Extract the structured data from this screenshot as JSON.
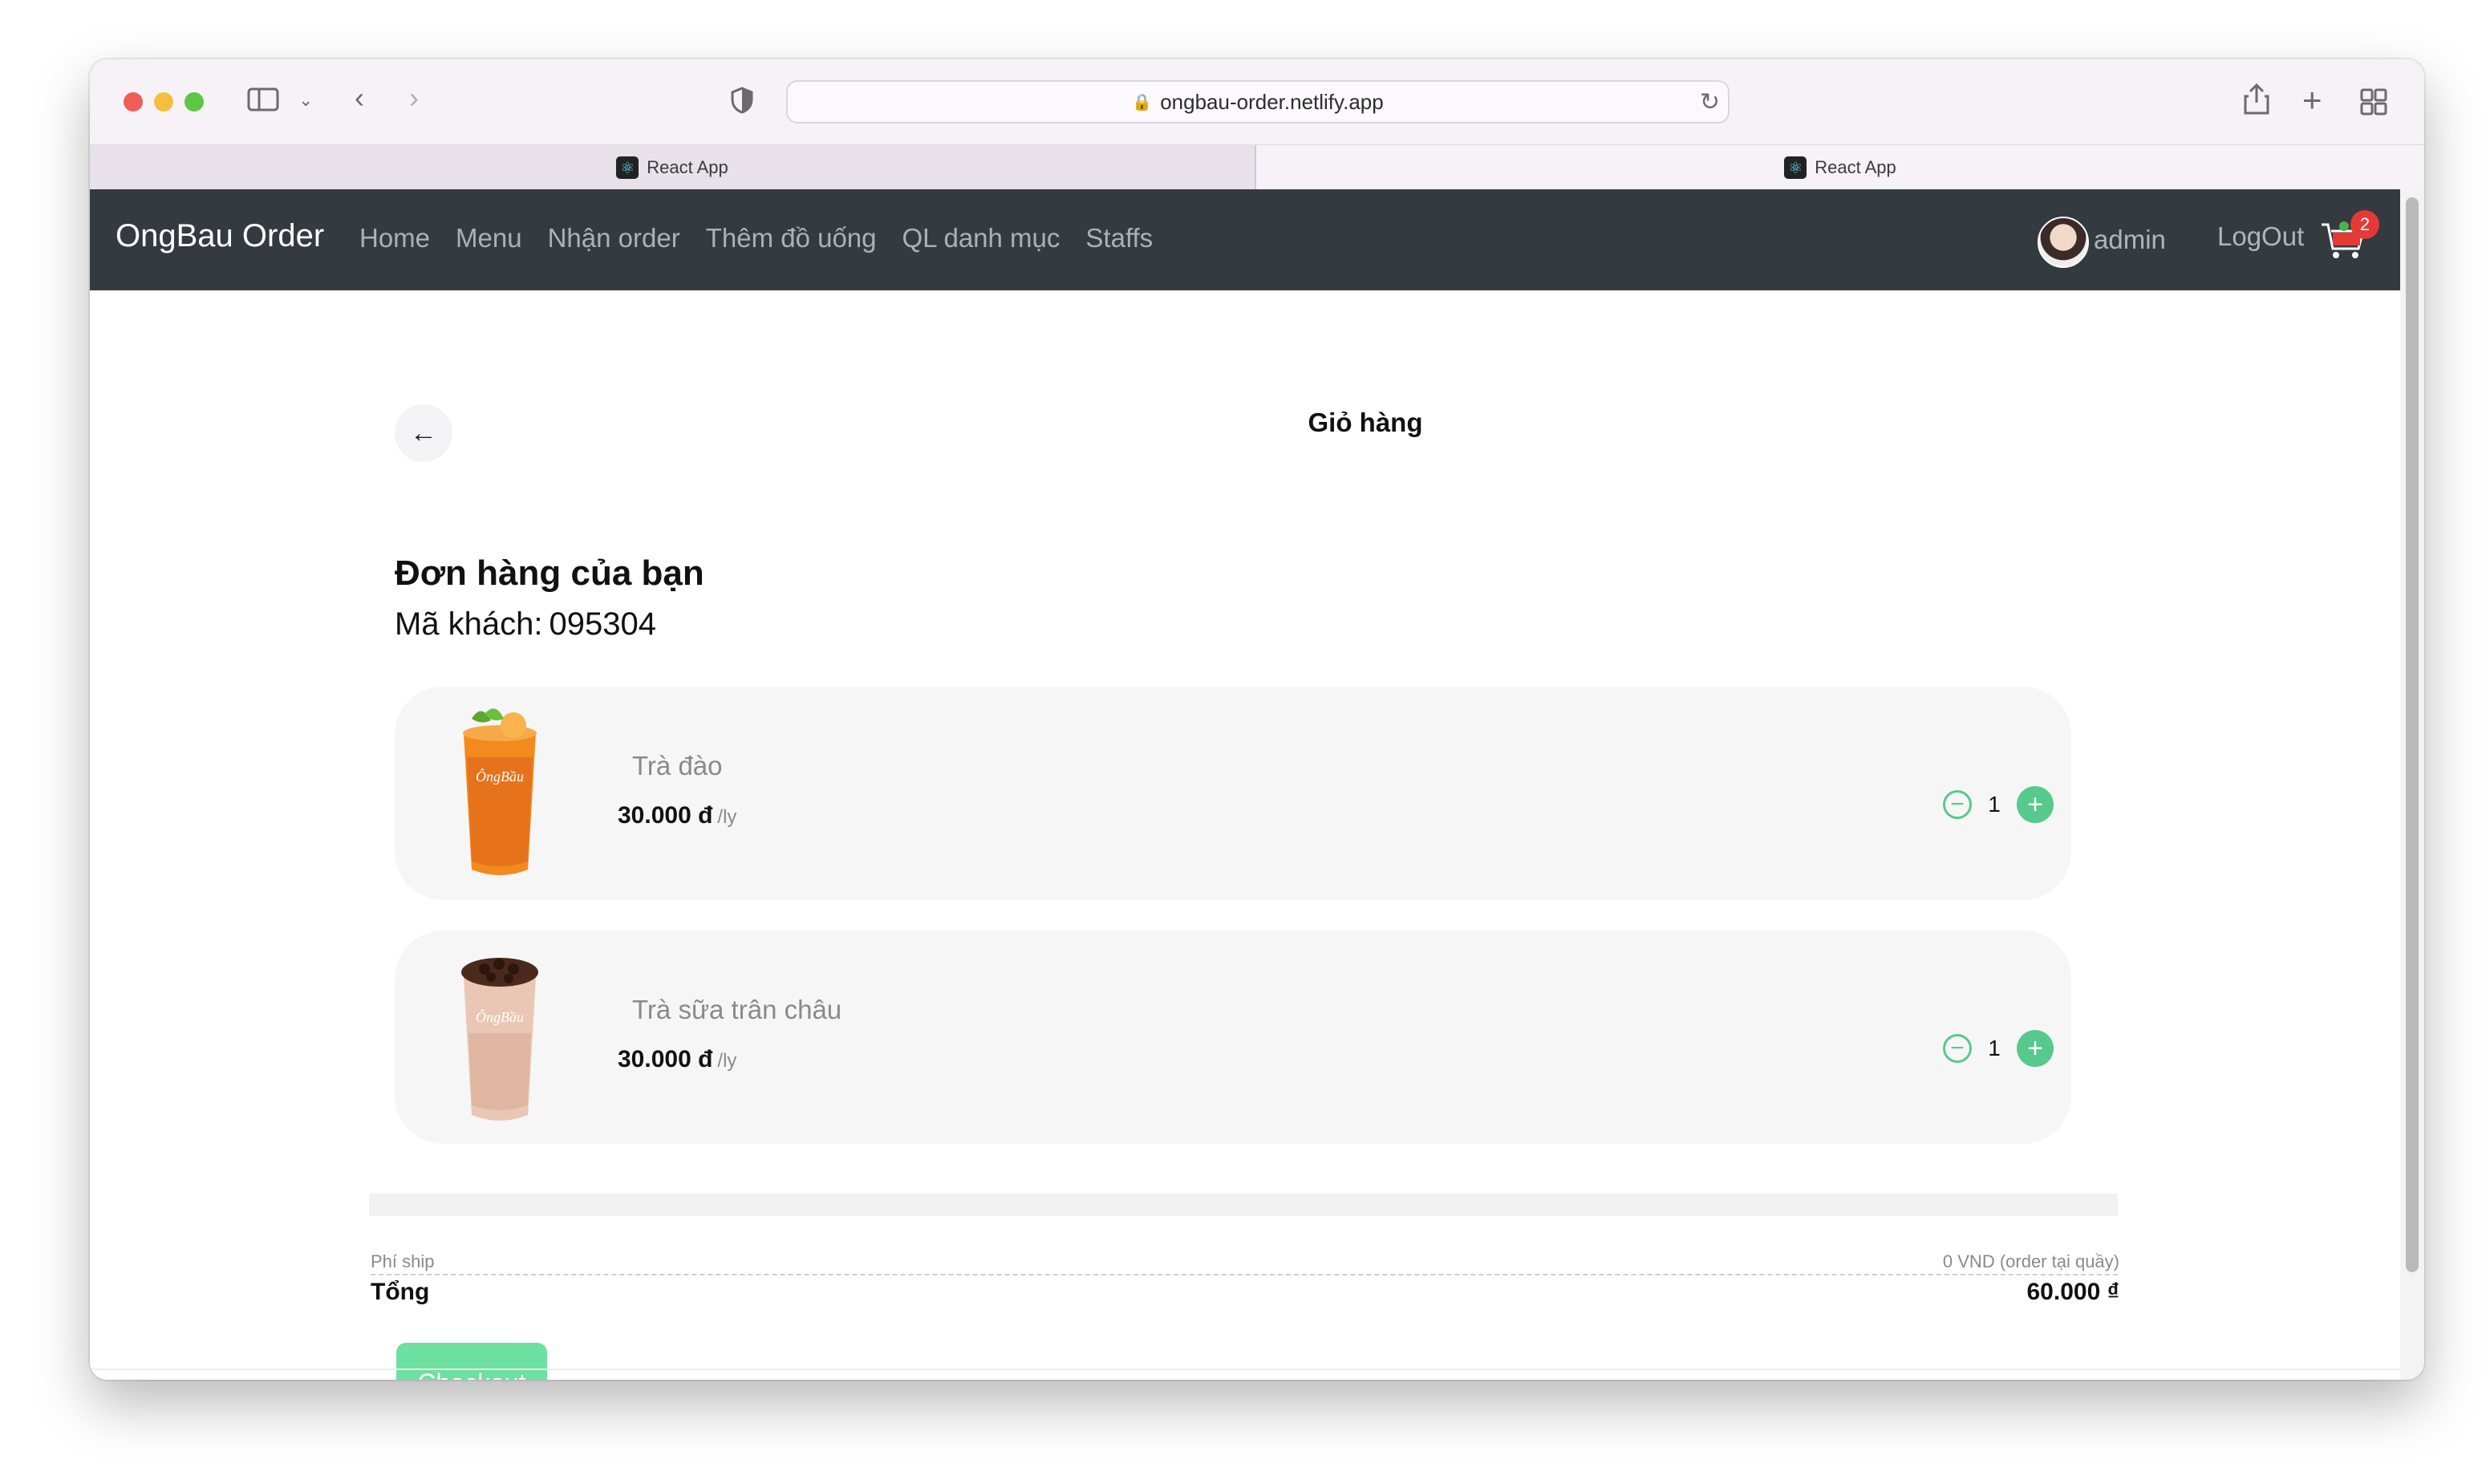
{
  "browser": {
    "url": "ongbau-order.netlify.app",
    "tabs": [
      {
        "title": "React App"
      },
      {
        "title": "React App"
      }
    ]
  },
  "navbar": {
    "brand": "OngBau Order",
    "links": [
      "Home",
      "Menu",
      "Nhận order",
      "Thêm đồ uống",
      "QL danh mục",
      "Staffs"
    ],
    "user": "admin",
    "logout": "LogOut",
    "cart_count": "2"
  },
  "page": {
    "title": "Giỏ hàng",
    "order_title": "Đơn hàng của bạn",
    "customer_label": "Mã khách:",
    "customer_code": "095304"
  },
  "items": [
    {
      "name": "Trà đào",
      "price": "30.000 đ",
      "unit": "/ly",
      "qty": "1"
    },
    {
      "name": "Trà sữa trân châu",
      "price": "30.000 đ",
      "unit": "/ly",
      "qty": "1"
    }
  ],
  "summary": {
    "ship_label": "Phí ship",
    "ship_value": "0 VND (order tại quầy)",
    "total_label": "Tổng",
    "total_value": "60.000 ₫",
    "checkout": "Checkout"
  },
  "colors": {
    "navbar": "#343a40",
    "accent_green": "#56c98d",
    "checkout_green": "#6ee0a0",
    "badge_red": "#e53935"
  }
}
